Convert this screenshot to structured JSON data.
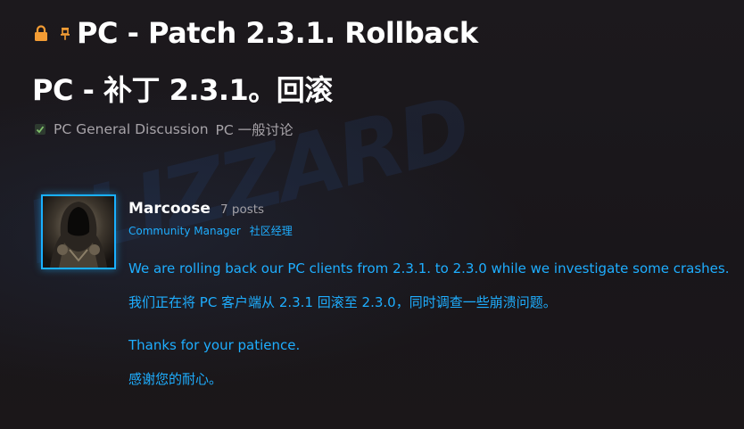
{
  "topic": {
    "title_en": "PC - Patch 2.3.1. Rollback",
    "title_zh": "PC - 补丁 2.3.1。回滚",
    "lock_icon": "lock-icon",
    "pin_icon": "pin-icon",
    "accent_lock_color": "#f39c34"
  },
  "category": {
    "icon": "shield-check-icon",
    "name_en": "PC General Discussion",
    "name_zh": "PC 一般讨论"
  },
  "post": {
    "author": {
      "name": "Marcoose",
      "post_count": "7 posts",
      "role_en": "Community Manager",
      "role_zh": "社区经理",
      "avatar": "hooded-figure-avatar",
      "avatar_border_color": "#19b0ff"
    },
    "body": [
      "We are rolling back our PC clients from 2.3.1. to 2.3.0 while we investigate some crashes.",
      "我们正在将 PC 客户端从 2.3.1 回滚至 2.3.0，同时调查一些崩溃问题。",
      "Thanks for your patience.",
      "感谢您的耐心。"
    ],
    "text_color": "#1eaeff"
  }
}
